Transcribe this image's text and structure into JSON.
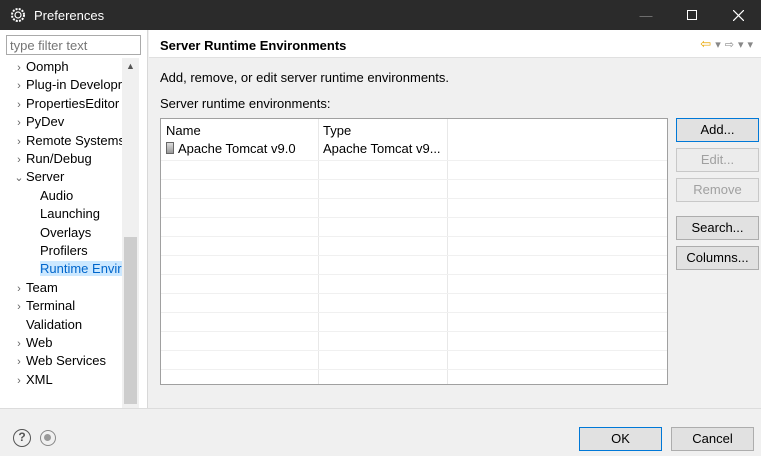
{
  "window": {
    "title": "Preferences"
  },
  "filter": {
    "placeholder": "type filter text"
  },
  "tree": [
    {
      "label": "Oomph",
      "arrow": "›"
    },
    {
      "label": "Plug-in Developr",
      "arrow": "›"
    },
    {
      "label": "PropertiesEditor",
      "arrow": "›"
    },
    {
      "label": "PyDev",
      "arrow": "›"
    },
    {
      "label": "Remote Systems",
      "arrow": "›"
    },
    {
      "label": "Run/Debug",
      "arrow": "›"
    },
    {
      "label": "Server",
      "arrow": "⌄"
    },
    {
      "label": "Audio",
      "arrow": ""
    },
    {
      "label": "Launching",
      "arrow": ""
    },
    {
      "label": "Overlays",
      "arrow": ""
    },
    {
      "label": "Profilers",
      "arrow": ""
    },
    {
      "label": "Runtime Enviro",
      "arrow": "",
      "selected": true
    },
    {
      "label": "Team",
      "arrow": "›"
    },
    {
      "label": "Terminal",
      "arrow": "›"
    },
    {
      "label": "Validation",
      "arrow": ""
    },
    {
      "label": "Web",
      "arrow": "›"
    },
    {
      "label": "Web Services",
      "arrow": "›"
    },
    {
      "label": "XML",
      "arrow": "›"
    }
  ],
  "page": {
    "title": "Server Runtime Environments",
    "description": "Add, remove, or edit server runtime environments.",
    "list_label": "Server runtime environments:"
  },
  "table": {
    "columns": [
      "Name",
      "Type"
    ],
    "rows": [
      {
        "name": "Apache Tomcat v9.0",
        "type": "Apache Tomcat v9..."
      }
    ]
  },
  "buttons": {
    "add": "Add...",
    "edit": "Edit...",
    "remove": "Remove",
    "search": "Search...",
    "columns": "Columns..."
  },
  "footer": {
    "ok": "OK",
    "cancel": "Cancel"
  },
  "colors": {
    "accent": "#0078d7",
    "selection": "#cce8ff",
    "titlebar": "#2b2b2b"
  }
}
